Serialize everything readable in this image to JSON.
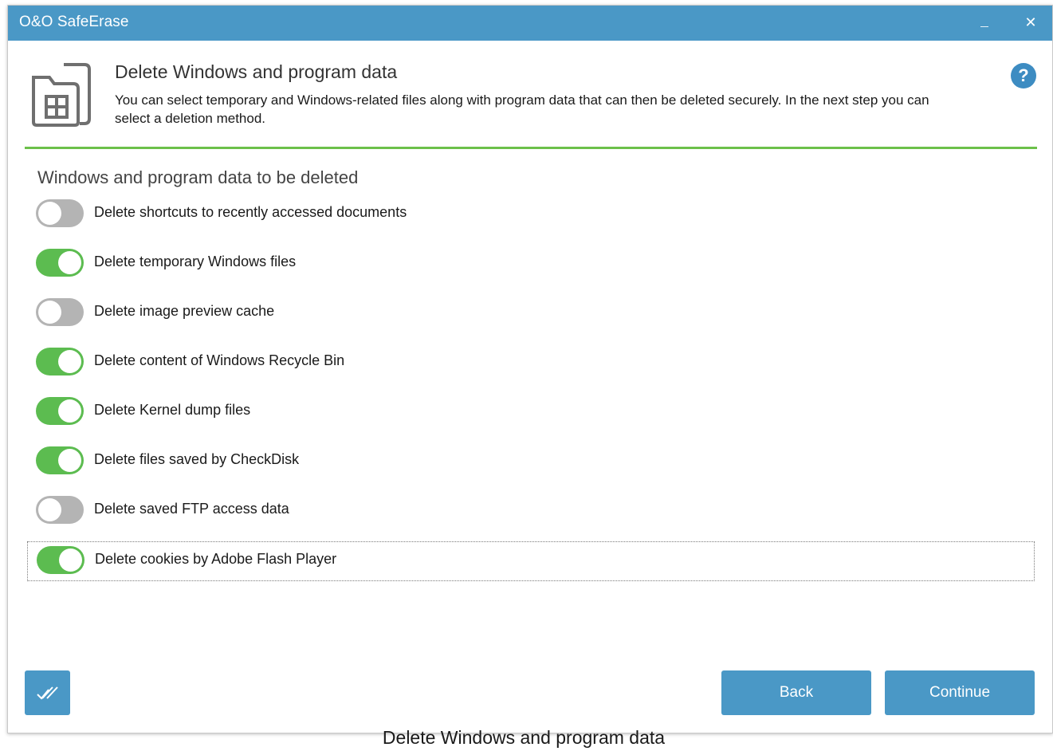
{
  "window": {
    "title": "O&O SafeErase",
    "minimize_label": "minimize",
    "close_label": "close",
    "titlebar_color": "#4a98c6"
  },
  "header": {
    "title": "Delete Windows and program data",
    "description": "You can select temporary and Windows-related files along with program data that can then be deleted securely. In the next step you can select a deletion method.",
    "help_icon": "?"
  },
  "section": {
    "title": "Windows and program data to be deleted"
  },
  "options": [
    {
      "label": "Delete shortcuts to recently accessed documents",
      "enabled": false
    },
    {
      "label": "Delete temporary Windows files",
      "enabled": true
    },
    {
      "label": "Delete image preview cache",
      "enabled": false
    },
    {
      "label": "Delete content of Windows Recycle Bin",
      "enabled": true
    },
    {
      "label": "Delete Kernel dump files",
      "enabled": true
    },
    {
      "label": "Delete files saved by CheckDisk",
      "enabled": true
    },
    {
      "label": "Delete saved FTP access data",
      "enabled": false
    },
    {
      "label": "Delete cookies by Adobe Flash Player",
      "enabled": true,
      "focused": true
    }
  ],
  "buttons": {
    "select_all_icon": "double-check-icon",
    "back": "Back",
    "continue": "Continue"
  },
  "caption": "Delete Windows and program data",
  "colors": {
    "accent": "#4a98c6",
    "toggle_on": "#5cbc50",
    "toggle_off": "#b4b4b4",
    "divider": "#6cc04a"
  }
}
